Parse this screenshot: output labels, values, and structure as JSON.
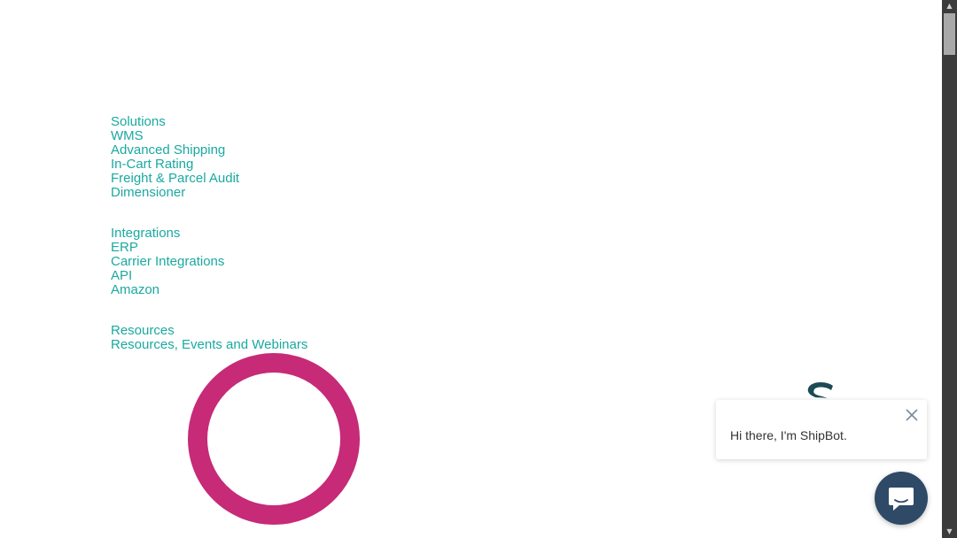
{
  "nav": {
    "solutions": {
      "heading": "Solutions",
      "items": [
        "WMS",
        "Advanced Shipping",
        "In-Cart Rating",
        "Freight & Parcel Audit",
        "Dimensioner"
      ]
    },
    "integrations": {
      "heading": "Integrations",
      "items": [
        "ERP",
        "Carrier Integrations",
        "API",
        "Amazon"
      ]
    },
    "resources": {
      "heading": "Resources",
      "items": [
        "Resources, Events and Webinars"
      ]
    }
  },
  "chat": {
    "greeting": "Hi there, I'm ShipBot.",
    "close_icon": "close-icon",
    "launcher_icon": "chat-bubble-icon",
    "bot_logo": "shipbot-logo"
  },
  "colors": {
    "link": "#1aa9a0",
    "ring": "#c72a77",
    "launcher": "#2e4a66",
    "logo": "#1c4a55"
  }
}
